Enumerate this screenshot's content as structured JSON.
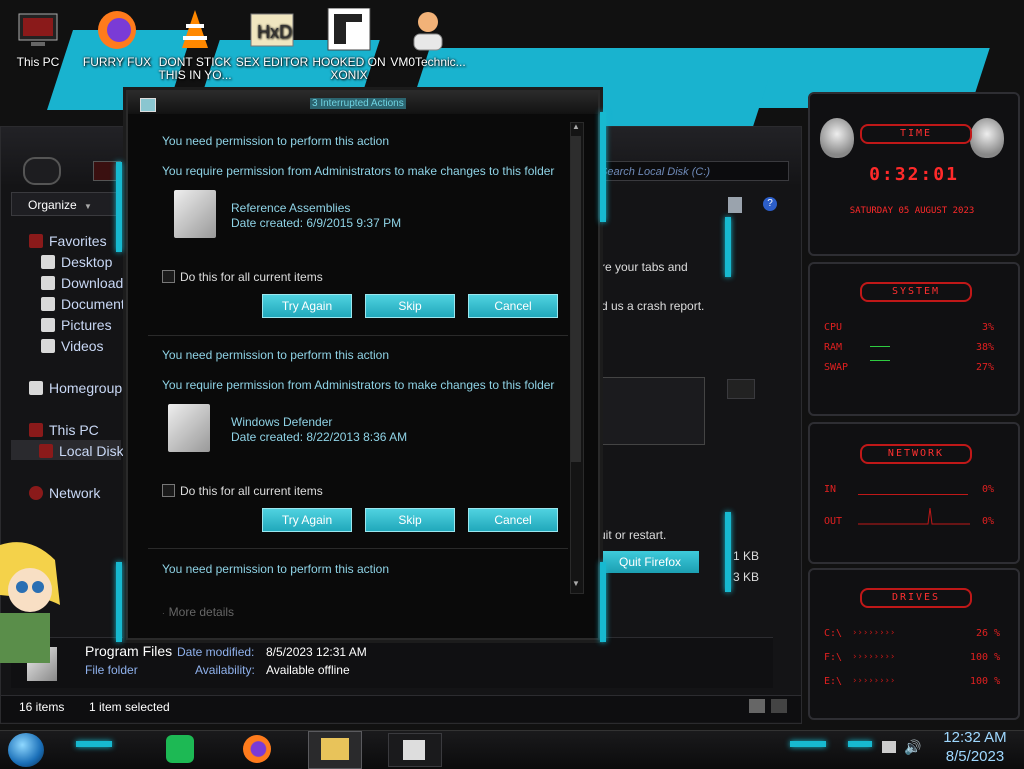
{
  "desktop": {
    "icons": [
      {
        "label": "This PC"
      },
      {
        "label": "FURRY FUX"
      },
      {
        "label": "DONT STICK THIS IN YO..."
      },
      {
        "label": "SEX EDITOR"
      },
      {
        "label": "HOOKED ON XONIX"
      },
      {
        "label": "VM0Technic..."
      }
    ]
  },
  "explorer": {
    "search_placeholder": "Search Local Disk (C:)",
    "organize_label": "Organize",
    "nav": {
      "favorites": "Favorites",
      "desktop": "Desktop",
      "downloads": "Downloads",
      "documents": "Document",
      "pictures": "Pictures",
      "videos": "Videos",
      "homegroup": "Homegroup",
      "this_pc": "This PC",
      "local_disk": "Local Disk",
      "network": "Network"
    },
    "bg_text": {
      "line1": "re your tabs and",
      "line2": "d us a crash report.",
      "line3": "uit or restart.",
      "size1": "1 KB",
      "size2": "3 KB",
      "quit_button": "Quit Firefox"
    },
    "details": {
      "name": "Program Files",
      "type": "File folder",
      "date_label": "Date modified:",
      "date_value": "8/5/2023 12:31 AM",
      "avail_label": "Availability:",
      "avail_value": "Available offline"
    },
    "status": {
      "items": "16 items",
      "selected": "1 item selected"
    }
  },
  "dialog": {
    "title": "3 Interrupted Actions",
    "entries": [
      {
        "heading": "You need permission to perform this action",
        "message": "You require permission from Administrators to make changes to this folder",
        "item_name": "Reference Assemblies",
        "item_date": "Date created: 6/9/2015 9:37 PM",
        "checkbox": "Do this for all current items",
        "try_again": "Try Again",
        "skip": "Skip",
        "cancel": "Cancel"
      },
      {
        "heading": "You need permission to perform this action",
        "message": "You require permission from Administrators to make changes to this folder",
        "item_name": "Windows Defender",
        "item_date": "Date created: 8/22/2013 8:36 AM",
        "checkbox": "Do this for all current items",
        "try_again": "Try Again",
        "skip": "Skip",
        "cancel": "Cancel"
      },
      {
        "heading": "You need permission to perform this action"
      }
    ],
    "more_details": "More details"
  },
  "gadgets": {
    "time": {
      "title": "TIME",
      "clock": "0:32:01",
      "date": "SATURDAY 05 AUGUST 2023"
    },
    "system": {
      "title": "SYSTEM",
      "cpu_label": "CPU",
      "cpu_value": "3%",
      "ram_label": "RAM",
      "ram_value": "38%",
      "swap_label": "SWAP",
      "swap_value": "27%"
    },
    "network": {
      "title": "NETWORK",
      "in_label": "IN",
      "in_value": "0%",
      "out_label": "OUT",
      "out_value": "0%"
    },
    "drives": {
      "title": "DRIVES",
      "c_label": "C:\\",
      "c_value": "26 %",
      "f_label": "F:\\",
      "f_value": "100 %",
      "e_label": "E:\\",
      "e_value": "100 %"
    }
  },
  "taskbar": {
    "time": "12:32 AM",
    "date": "8/5/2023"
  },
  "colors": {
    "teal": "#17b9d0",
    "red": "#e02020",
    "link_blue": "#8fd3e6"
  }
}
